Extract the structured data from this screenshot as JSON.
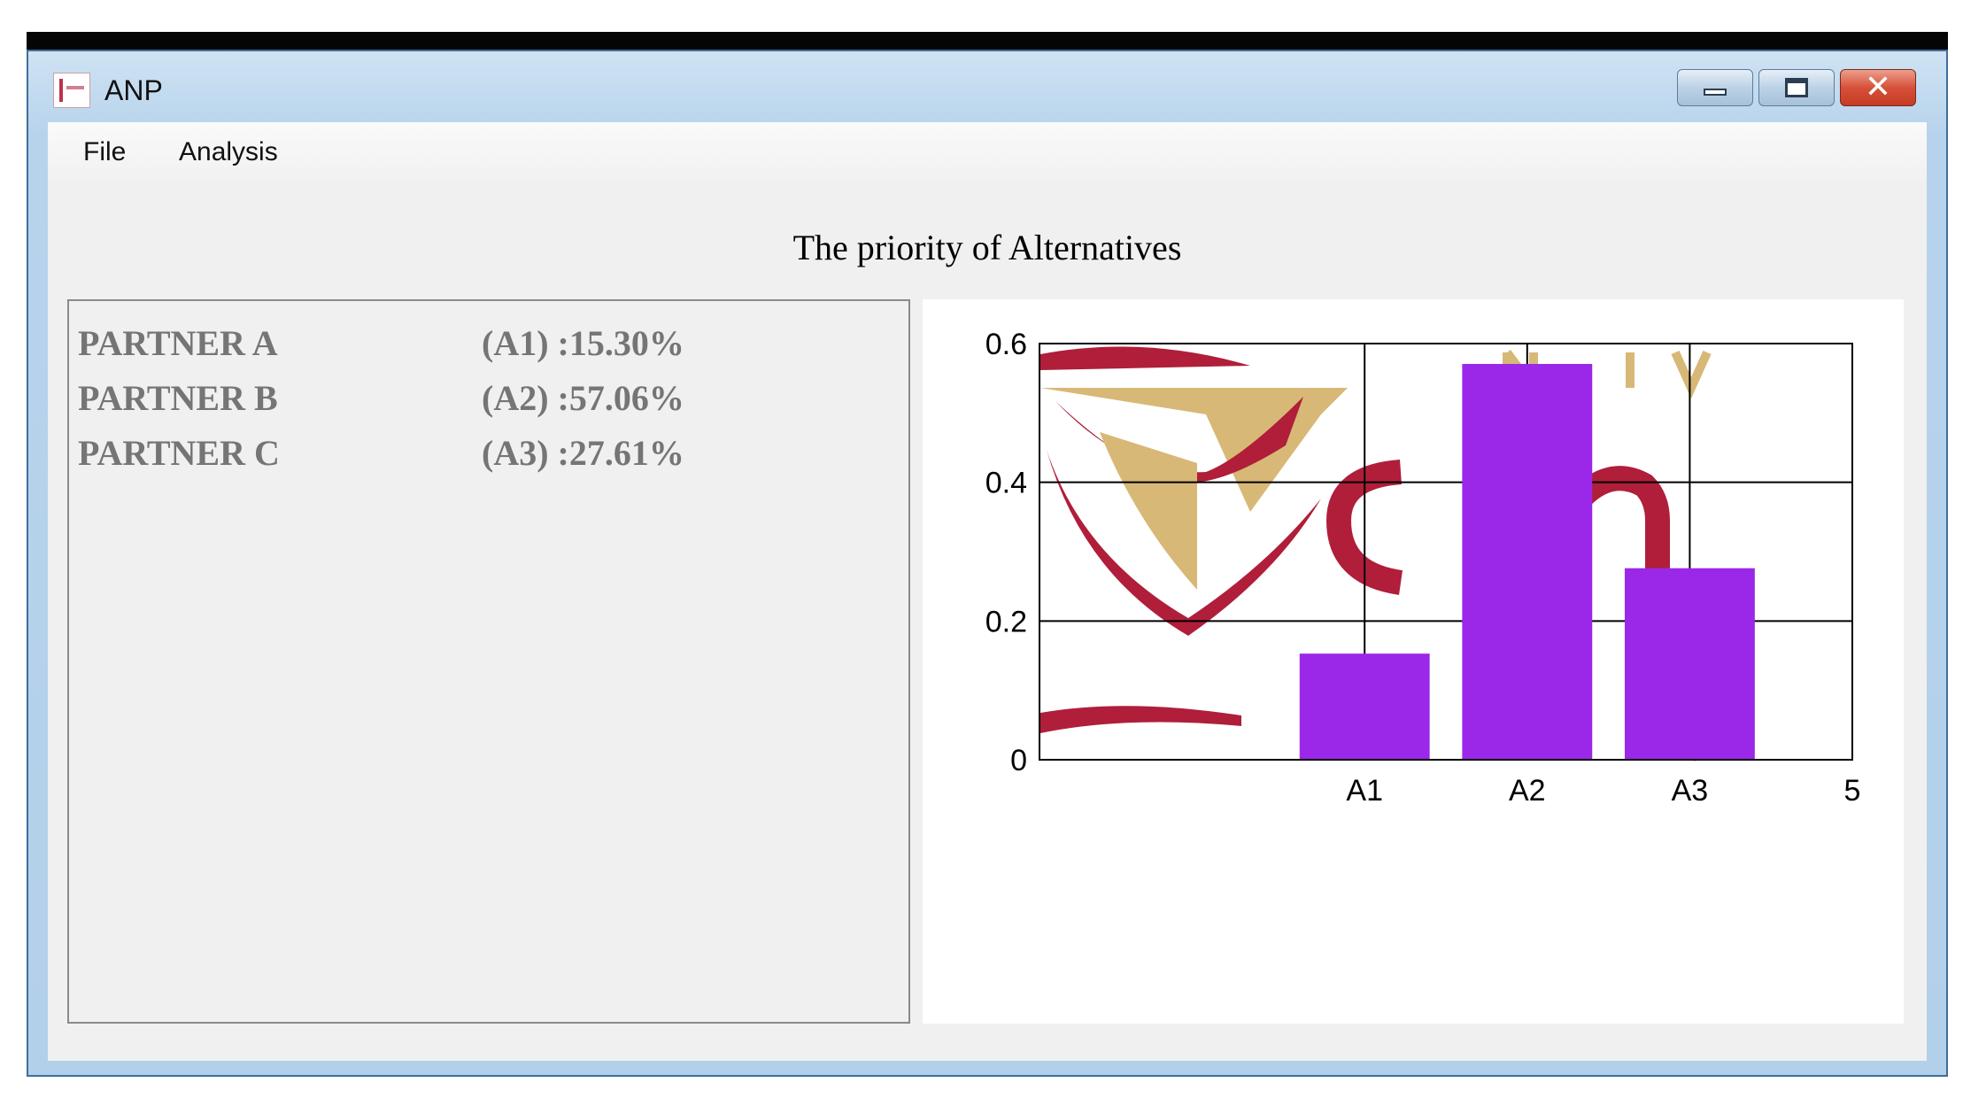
{
  "window": {
    "title": "ANP"
  },
  "menu": {
    "file": "File",
    "analysis": "Analysis"
  },
  "page_title": "The priority of Alternatives",
  "results": [
    {
      "name": "PARTNER A",
      "value": "(A1) :15.30%"
    },
    {
      "name": "PARTNER B",
      "value": "(A2) :57.06%"
    },
    {
      "name": "PARTNER C",
      "value": "(A3) :27.61%"
    }
  ],
  "colors": {
    "bar": "#9b27e8",
    "logo_red": "#b01e3a",
    "logo_gold": "#d8b876",
    "grid": "#000000"
  },
  "chart_data": {
    "type": "bar",
    "categories": [
      "A1",
      "A2",
      "A3"
    ],
    "x_positions": [
      2,
      3,
      4
    ],
    "values": [
      0.153,
      0.5706,
      0.2761
    ],
    "xlim": [
      0,
      5
    ],
    "ylim": [
      0,
      0.6
    ],
    "x_tick_labels": [
      "A1",
      "A2",
      "A3",
      "5"
    ],
    "y_ticks": [
      0,
      0.2,
      0.4,
      0.6
    ],
    "y_tick_labels": [
      "0",
      "0.2",
      "0.4",
      "0.6"
    ],
    "grid": true,
    "background_logo": true
  }
}
